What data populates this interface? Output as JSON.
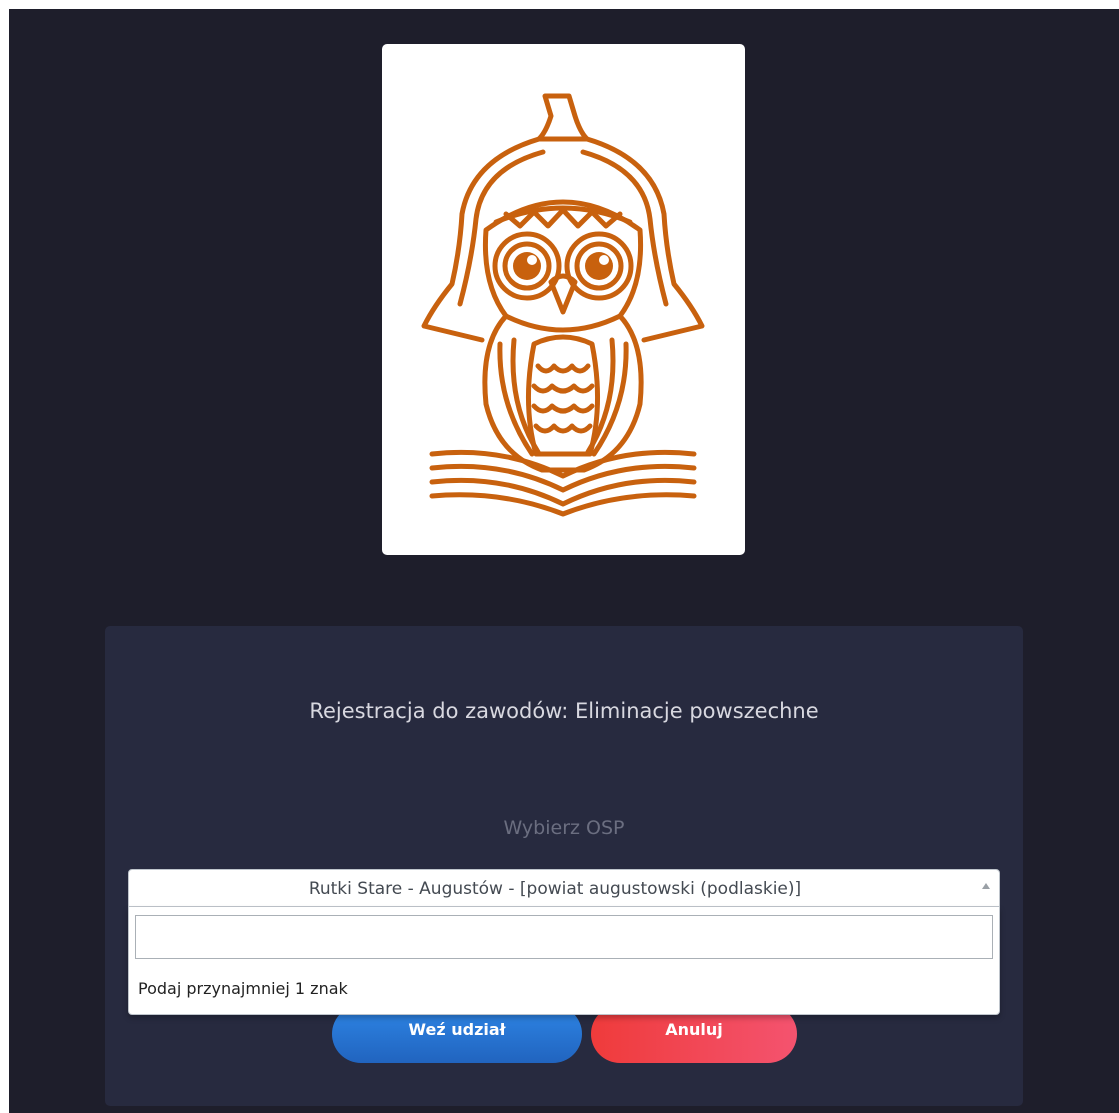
{
  "logo": {
    "icon": "owl-on-book-logo",
    "color": "#c8610e"
  },
  "form": {
    "title": "Rejestracja do zawodów: Eliminacje powszechne",
    "select_label": "Wybierz OSP",
    "selected_value": "Rutki Stare - Augustów - [powiat augustowski (podlaskie)]",
    "search_value": "",
    "search_hint": "Podaj przynajmniej 1 znak",
    "join_button": "Weź udział",
    "cancel_button": "Anuluj"
  },
  "colors": {
    "background": "#1e1e2b",
    "panel": "#272a3f",
    "join_button": "#2a78d9",
    "cancel_button": "#f0455a"
  }
}
